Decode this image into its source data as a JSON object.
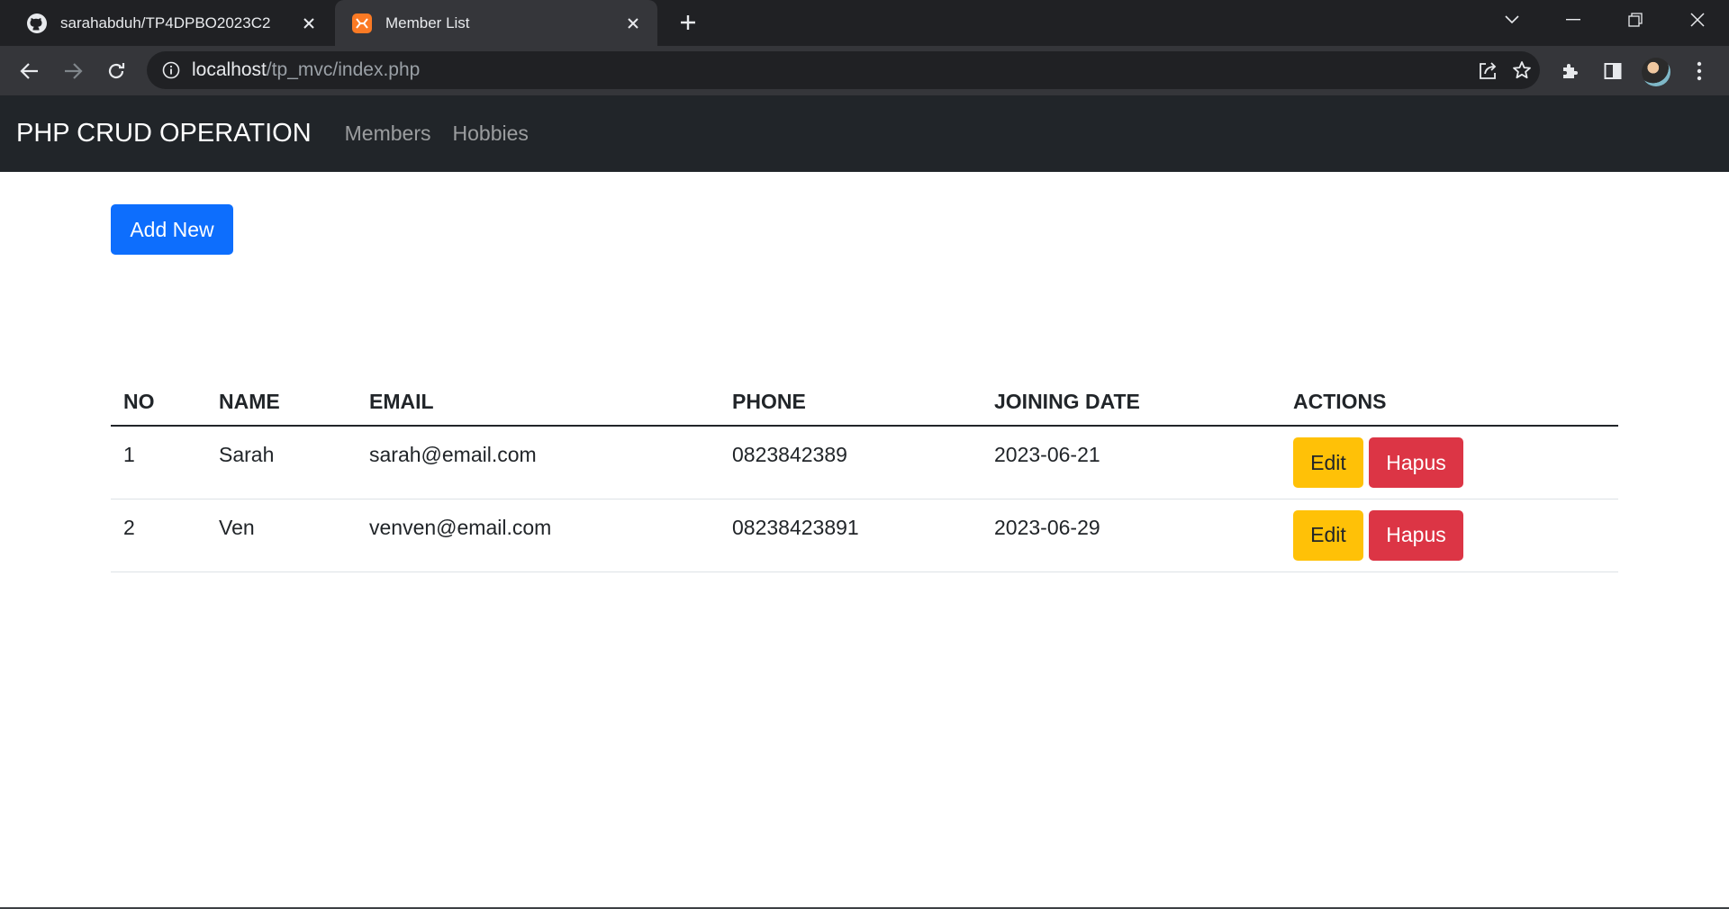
{
  "browser": {
    "tabs": [
      {
        "title": "sarahabduh/TP4DPBO2023C2",
        "favicon": "github-icon",
        "active": false
      },
      {
        "title": "Member List",
        "favicon": "xampp-icon",
        "active": true
      }
    ],
    "url_host": "localhost",
    "url_path": "/tp_mvc/index.php"
  },
  "navbar": {
    "brand": "PHP CRUD OPERATION",
    "links": [
      "Members",
      "Hobbies"
    ]
  },
  "main": {
    "add_button": "Add New",
    "table": {
      "headers": [
        "NO",
        "NAME",
        "EMAIL",
        "PHONE",
        "JOINING DATE",
        "ACTIONS"
      ],
      "rows": [
        {
          "no": "1",
          "name": "Sarah",
          "email": "sarah@email.com",
          "phone": "0823842389",
          "joining_date": "2023-06-21",
          "edit": "Edit",
          "delete": "Hapus"
        },
        {
          "no": "2",
          "name": "Ven",
          "email": "venven@email.com",
          "phone": "08238423891",
          "joining_date": "2023-06-29",
          "edit": "Edit",
          "delete": "Hapus"
        }
      ]
    }
  },
  "colors": {
    "navbar_bg": "#212529",
    "primary": "#0d6efd",
    "warning": "#ffc107",
    "danger": "#dc3545",
    "chrome_dark": "#202124",
    "chrome_toolbar": "#35363a"
  }
}
